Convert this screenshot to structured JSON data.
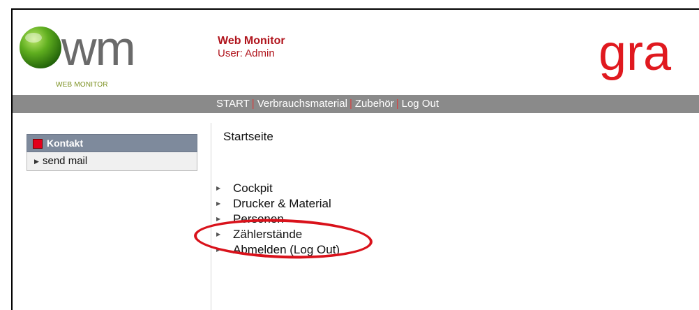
{
  "header": {
    "logo_text": "wm",
    "logo_sub": "WEB MONITOR",
    "app_name": "Web Monitor",
    "user_line": "User: Admin",
    "brand_text": "gra"
  },
  "nav": {
    "items": [
      "START",
      "Verbrauchsmaterial",
      "Zubehör",
      "Log Out"
    ],
    "separator": "|"
  },
  "sidebar": {
    "heading": "Kontakt",
    "items": [
      {
        "label": "send mail"
      }
    ]
  },
  "main": {
    "title": "Startseite",
    "menu": [
      {
        "label": "Cockpit"
      },
      {
        "label": "Drucker & Material"
      },
      {
        "label": "Personen"
      },
      {
        "label": "Zählerstände"
      },
      {
        "label": "Abmelden (Log Out)"
      }
    ]
  },
  "colors": {
    "accent_red": "#e0191f",
    "nav_gray": "#8a8a8a",
    "sidebar_head": "#7e8a9c",
    "logo_green": "#4a9e1a"
  },
  "icons": [
    "logo-ball-icon",
    "kontakt-square-icon",
    "arrow-right-icon"
  ]
}
